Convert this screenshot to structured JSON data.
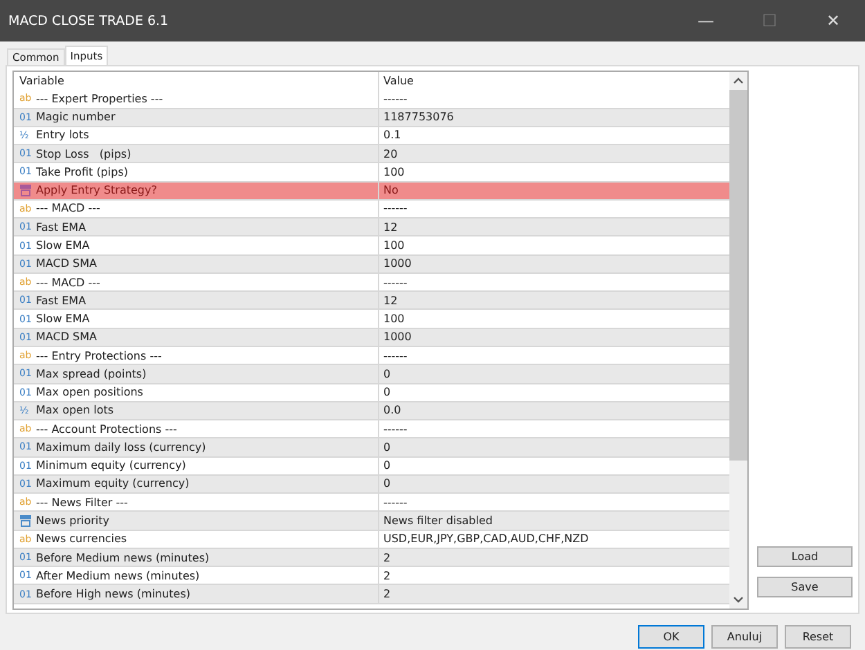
{
  "window": {
    "title": "MACD CLOSE TRADE 6.1",
    "controls": [
      "—",
      "☐",
      "✕"
    ]
  },
  "tabs": [
    {
      "label": "Common",
      "selected": false
    },
    {
      "label": "Inputs",
      "selected": true
    }
  ],
  "table": {
    "columns": [
      "Variable",
      "Value"
    ],
    "rows": [
      {
        "kind": "string",
        "icon": "ab",
        "variable": "--- Expert Properties ---",
        "value": "------",
        "selected": false
      },
      {
        "kind": "int",
        "icon": "01",
        "variable": "Magic number",
        "value": "1187753076",
        "selected": false
      },
      {
        "kind": "double",
        "icon": "½",
        "variable": "Entry lots",
        "value": "0.1",
        "selected": false
      },
      {
        "kind": "int",
        "icon": "01",
        "variable": "Stop Loss   (pips)",
        "value": "20",
        "selected": false
      },
      {
        "kind": "int",
        "icon": "01",
        "variable": "Take Profit (pips)",
        "value": "100",
        "selected": false
      },
      {
        "kind": "enum",
        "variable": "Apply Entry Strategy?",
        "value": "No",
        "selected": true
      },
      {
        "kind": "string",
        "icon": "ab",
        "variable": "--- MACD ---",
        "value": "------",
        "selected": false
      },
      {
        "kind": "int",
        "icon": "01",
        "variable": "Fast EMA",
        "value": "12",
        "selected": false
      },
      {
        "kind": "int",
        "icon": "01",
        "variable": "Slow EMA",
        "value": "100",
        "selected": false
      },
      {
        "kind": "int",
        "icon": "01",
        "variable": "MACD SMA",
        "value": "1000",
        "selected": false
      },
      {
        "kind": "string",
        "icon": "ab",
        "variable": "--- MACD ---",
        "value": "------",
        "selected": false
      },
      {
        "kind": "int",
        "icon": "01",
        "variable": "Fast EMA",
        "value": "12",
        "selected": false
      },
      {
        "kind": "int",
        "icon": "01",
        "variable": "Slow EMA",
        "value": "100",
        "selected": false
      },
      {
        "kind": "int",
        "icon": "01",
        "variable": "MACD SMA",
        "value": "1000",
        "selected": false
      },
      {
        "kind": "string",
        "icon": "ab",
        "variable": "--- Entry Protections ---",
        "value": "------",
        "selected": false
      },
      {
        "kind": "int",
        "icon": "01",
        "variable": "Max spread (points)",
        "value": "0",
        "selected": false
      },
      {
        "kind": "int",
        "icon": "01",
        "variable": "Max open positions",
        "value": "0",
        "selected": false
      },
      {
        "kind": "double",
        "icon": "½",
        "variable": "Max open lots",
        "value": "0.0",
        "selected": false
      },
      {
        "kind": "string",
        "icon": "ab",
        "variable": "--- Account Protections ---",
        "value": "------",
        "selected": false
      },
      {
        "kind": "int",
        "icon": "01",
        "variable": "Maximum daily loss (currency)",
        "value": "0",
        "selected": false
      },
      {
        "kind": "int",
        "icon": "01",
        "variable": "Minimum equity (currency)",
        "value": "0",
        "selected": false
      },
      {
        "kind": "int",
        "icon": "01",
        "variable": "Maximum equity (currency)",
        "value": "0",
        "selected": false
      },
      {
        "kind": "string",
        "icon": "ab",
        "variable": "--- News Filter ---",
        "value": "------",
        "selected": false
      },
      {
        "kind": "enum",
        "variable": "News priority",
        "value": "News filter disabled",
        "selected": false
      },
      {
        "kind": "string",
        "icon": "ab",
        "variable": "News currencies",
        "value": "USD,EUR,JPY,GBP,CAD,AUD,CHF,NZD",
        "selected": false
      },
      {
        "kind": "int",
        "icon": "01",
        "variable": "Before Medium news (minutes)",
        "value": "2",
        "selected": false
      },
      {
        "kind": "int",
        "icon": "01",
        "variable": "After Medium news (minutes)",
        "value": "2",
        "selected": false
      },
      {
        "kind": "int",
        "icon": "01",
        "variable": "Before High news (minutes)",
        "value": "2",
        "selected": false
      }
    ]
  },
  "side_buttons": [
    "Load",
    "Save"
  ],
  "buttons": [
    {
      "label": "OK",
      "default": true
    },
    {
      "label": "Anuluj",
      "default": false
    },
    {
      "label": "Reset",
      "default": false
    }
  ]
}
